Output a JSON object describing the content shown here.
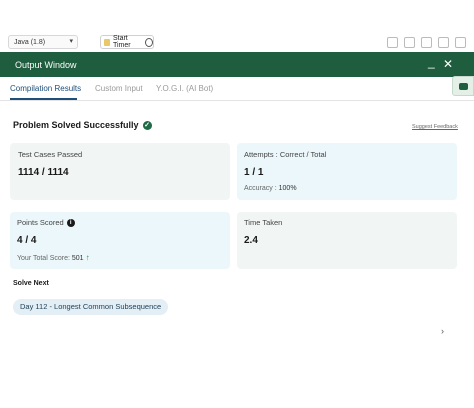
{
  "toolbar": {
    "language": "Java (1.8)",
    "timer_label": "Start Timer"
  },
  "window": {
    "title": "Output Window"
  },
  "tabs": [
    {
      "label": "Compilation Results",
      "active": true
    },
    {
      "label": "Custom Input",
      "active": false
    },
    {
      "label": "Y.O.G.I. (AI Bot)",
      "active": false
    }
  ],
  "result": {
    "status": "Problem Solved Successfully",
    "feedback_link": "Suggest Feedback"
  },
  "cards": {
    "test_cases": {
      "label": "Test Cases Passed",
      "value": "1114 / 1114"
    },
    "attempts": {
      "label": "Attempts : Correct / Total",
      "value": "1 / 1",
      "accuracy_label": "Accuracy :",
      "accuracy_value": "100%"
    },
    "points": {
      "label": "Points Scored",
      "value": "4 / 4",
      "total_label": "Your Total Score:",
      "total_value": "501"
    },
    "time": {
      "label": "Time Taken",
      "value": "2.4"
    }
  },
  "solve_next": {
    "heading": "Solve Next",
    "problem": "Day 112 - Longest Common Subsequence"
  },
  "colors": {
    "header_bg": "#1e5d3e",
    "accent_blue": "#1e4e7a",
    "card_gray": "#f1f5f3",
    "card_blue": "#ebf7fa",
    "success": "#1f6b45"
  },
  "icons": [
    "chevron-down-icon",
    "timer-icon",
    "play-icon",
    "minimize-icon",
    "close-icon",
    "chat-icon",
    "check-circle-icon",
    "info-icon",
    "arrow-up-icon",
    "chevron-right-icon"
  ]
}
